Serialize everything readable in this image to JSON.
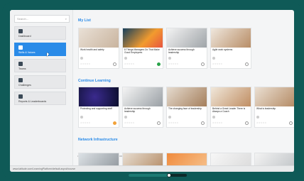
{
  "sidebar": {
    "search_placeholder": "Search...",
    "items": [
      {
        "label": "Dashboard",
        "icon": "dashboard-icon"
      },
      {
        "label": "Skills & Values",
        "icon": "person-icon",
        "active": true
      },
      {
        "label": "Teams",
        "icon": "teams-icon"
      },
      {
        "label": "Challenges",
        "icon": "trophy-icon"
      },
      {
        "label": "Reports & Leaderboards",
        "icon": "chart-icon"
      }
    ]
  },
  "sections": [
    {
      "title": "My List",
      "cards": [
        {
          "title": "Work health and safety",
          "status": "neutral"
        },
        {
          "title": "8 Things Managers Do That Make Good Employees",
          "status": "ok"
        },
        {
          "title": "Achieve success through leadership",
          "status": "neutral"
        },
        {
          "title": "Agile work systems",
          "status": "neutral"
        }
      ]
    },
    {
      "title": "Continue Learning",
      "cards": [
        {
          "title": "Protecting and supporting staff",
          "status": "warn"
        },
        {
          "title": "Achieve success through leadership",
          "status": "neutral"
        },
        {
          "title": "The changing face of leadership",
          "status": "neutral"
        },
        {
          "title": "Behind a Great Leader There is Always a Coach",
          "status": "neutral"
        },
        {
          "title": "What is leadership",
          "status": "neutral"
        }
      ]
    },
    {
      "title": "Network Infrastructure",
      "cards": []
    }
  ],
  "url": "www.latitude.com/LearningPlatform/default.aspx#/course",
  "colors": {
    "accent": "#2a8be8",
    "frame": "#0f5a57"
  },
  "scrubber": {
    "progress": 0.7
  }
}
